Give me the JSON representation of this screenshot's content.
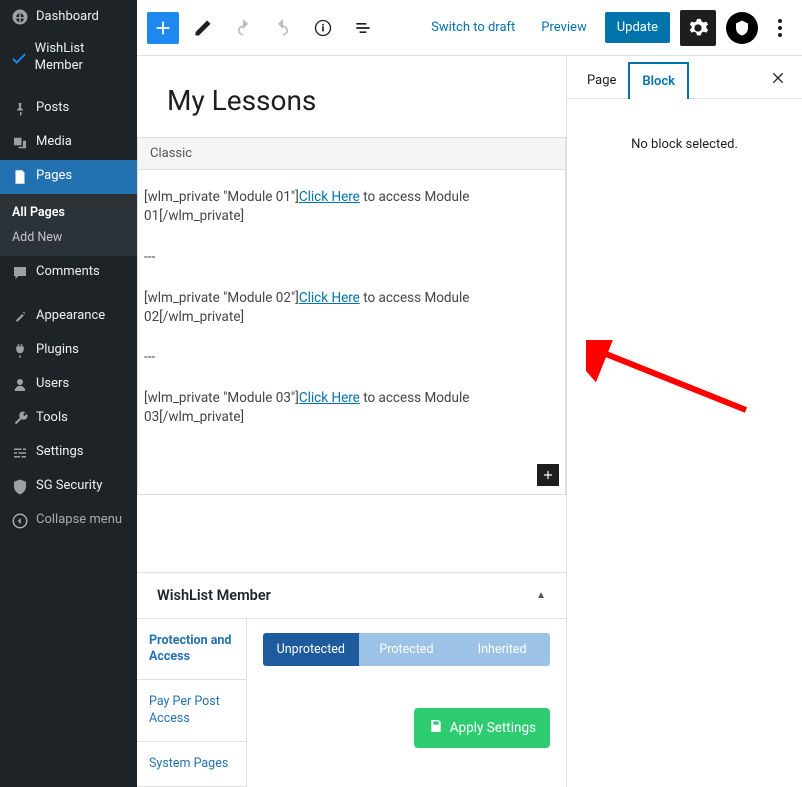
{
  "sidebar": {
    "items": [
      {
        "label": "Dashboard"
      },
      {
        "label": "WishList Member"
      },
      {
        "label": "Posts"
      },
      {
        "label": "Media"
      },
      {
        "label": "Pages"
      },
      {
        "label": "Comments"
      },
      {
        "label": "Appearance"
      },
      {
        "label": "Plugins"
      },
      {
        "label": "Users"
      },
      {
        "label": "Tools"
      },
      {
        "label": "Settings"
      },
      {
        "label": "SG Security"
      },
      {
        "label": "Collapse menu"
      }
    ],
    "pages_submenu": [
      {
        "label": "All Pages"
      },
      {
        "label": "Add New"
      }
    ]
  },
  "topbar": {
    "switch_draft": "Switch to draft",
    "preview": "Preview",
    "update": "Update"
  },
  "editor": {
    "title": "My Lessons",
    "classic_label": "Classic",
    "lines": {
      "l1_pre": "[wlm_private \"Module 01\"]",
      "l1_link": "Click Here",
      "l1_post": " to access Module 01[/wlm_private]",
      "sep": "---",
      "l2_pre": "[wlm_private \"Module 02\"]",
      "l2_link": "Click Here",
      "l2_post": " to access Module 02[/wlm_private]",
      "l3_pre": "[wlm_private \"Module 03\"]",
      "l3_link": "Click Here",
      "l3_post": " to access Module 03[/wlm_private]"
    }
  },
  "bottom": {
    "title": "WishList Member",
    "tabs": [
      {
        "label": "Protection and Access"
      },
      {
        "label": "Pay Per Post Access"
      },
      {
        "label": "System Pages"
      }
    ],
    "seg": {
      "unprotected": "Unprotected",
      "protected": "Protected",
      "inherited": "Inherited"
    },
    "apply": "Apply Settings"
  },
  "inspector": {
    "tabs": {
      "page": "Page",
      "block": "Block"
    },
    "empty": "No block selected."
  }
}
